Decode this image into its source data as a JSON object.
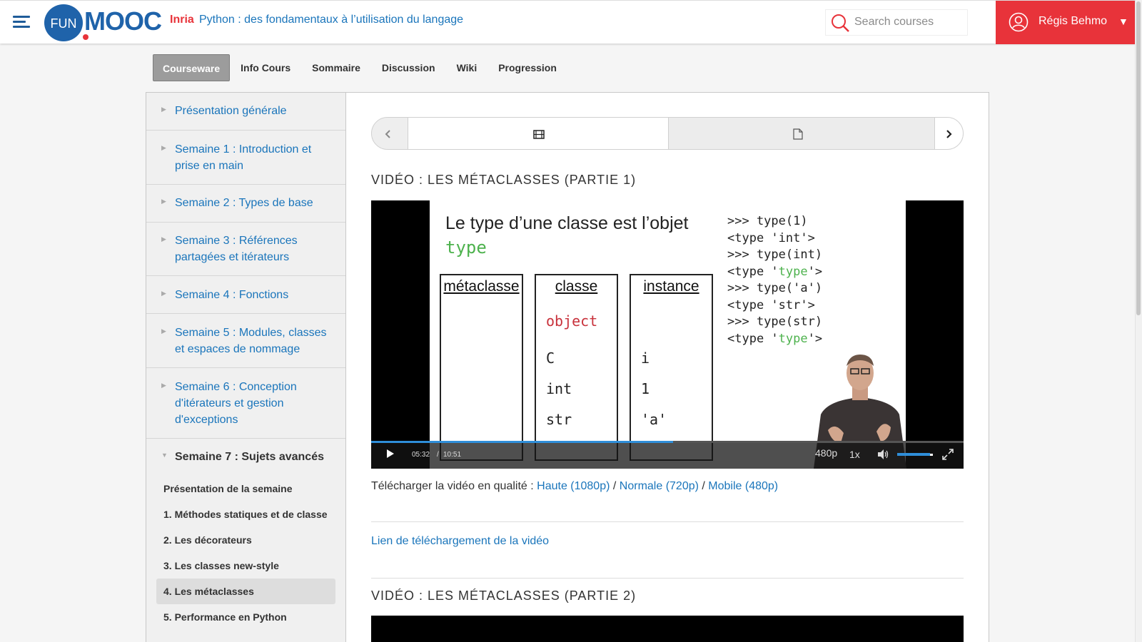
{
  "header": {
    "logo_circle": "FUN",
    "logo_text": "MOOC",
    "course_org": "Inria",
    "course_title": "Python : des fondamentaux à l’utilisation du langage",
    "search_placeholder": "Search courses",
    "user_name": "Régis Behmo",
    "user_caret": "▼"
  },
  "tabs": [
    "Courseware",
    "Info Cours",
    "Sommaire",
    "Discussion",
    "Wiki",
    "Progression"
  ],
  "active_tab": "Courseware",
  "sidebar": {
    "chapters": [
      "Présentation générale",
      "Semaine 1 : Introduction et prise en main",
      "Semaine 2 : Types de base",
      "Semaine 3 : Références partagées et itérateurs",
      "Semaine 4 : Fonctions",
      "Semaine 5 : Modules, classes et espaces de nommage",
      "Semaine 6 : Conception d'itérateurs et gestion d'exceptions",
      "Semaine 7 : Sujets avancés"
    ],
    "sections": [
      "Présentation de la semaine",
      "1. Méthodes statiques et de classe",
      "2. Les décorateurs",
      "3. Les classes new-style",
      "4. Les métaclasses",
      "5. Performance en Python"
    ],
    "active_section": "4. Les métaclasses"
  },
  "content": {
    "video1_title": "VIDÉO : LES MÉTACLASSES (PARTIE 1)",
    "video2_title": "VIDÉO : LES MÉTACLASSES (PARTIE 2)",
    "slide": {
      "title": "Le type d’une classe est l’objet",
      "type_word": "type",
      "col1": "métaclasse",
      "col2": "classe",
      "col3": "instance",
      "object": "object",
      "c": "C",
      "int": "int",
      "str": "str",
      "i": "i",
      "one": "1",
      "a": "'a'",
      "repl": [
        [
          ">>> type(1)"
        ],
        [
          "<type 'int'>"
        ],
        [
          ">>> type(int)"
        ],
        [
          "<type '",
          "type",
          "'>"
        ],
        [
          ">>> type('a')"
        ],
        [
          "<type 'str'>"
        ],
        [
          ">>> type(str)"
        ],
        [
          "<type '",
          "type",
          "'>"
        ]
      ]
    },
    "player": {
      "current_time": "05:32",
      "separator": "/",
      "total_time": "10:51",
      "quality": "480p",
      "speed": "1x",
      "progress": 0.51,
      "volume": 0.92
    },
    "download": {
      "prefix": "Télécharger la vidéo en qualité : ",
      "high": "Haute (1080p)",
      "normal": "Normale (720p)",
      "mobile": "Mobile (480p)",
      "sep": " / "
    },
    "download_link": "Lien de téléchargement de la vidéo"
  },
  "colors": {
    "brand_blue": "#1f63aa",
    "brand_red": "#e8333a",
    "link": "#1a75bb",
    "code_green": "#4db24d",
    "code_red": "#c8323c"
  },
  "icons": {
    "menu": "hamburger-icon",
    "search": "search-icon",
    "user": "user-circle-icon",
    "seq_video": "film-icon",
    "seq_doc": "document-icon"
  }
}
